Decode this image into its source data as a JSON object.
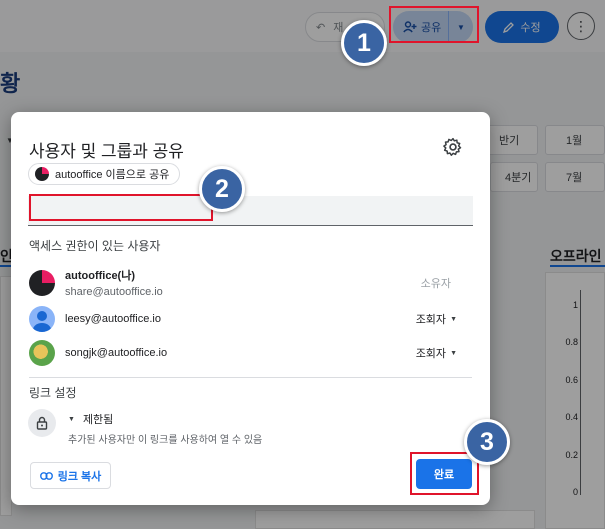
{
  "background": {
    "undo_label": "재",
    "share_label": "공유",
    "edit_label": "수정",
    "page_heading": "황",
    "filter_chips": [
      {
        "label": "반기"
      },
      {
        "label": "1월"
      },
      {
        "label": "4분기"
      },
      {
        "label": "7월"
      }
    ],
    "left_section_title": "인",
    "right_chart": {
      "title": "오프라인",
      "chart_data": {
        "type": "line",
        "title": "오프라인",
        "y_ticks": [
          "1",
          "0.8",
          "0.6",
          "0.4",
          "0.2",
          "0"
        ],
        "ylim": [
          0,
          1
        ]
      }
    }
  },
  "dialog": {
    "title": "사용자 및 그룹과 공유",
    "identity_chip": "autooffice 이름으로 공유",
    "add_input_value": "",
    "access_section_label": "액세스 권한이 있는 사용자",
    "people": [
      {
        "name": "autooffice(나)",
        "email": "share@autooffice.io",
        "role": "소유자"
      },
      {
        "name": "leesy@autooffice.io",
        "email": "",
        "role": "조회자"
      },
      {
        "name": "songjk@autooffice.io",
        "email": "",
        "role": "조회자"
      }
    ],
    "link_section_label": "링크 설정",
    "restriction_label": "제한됨",
    "restriction_desc": "추가된 사용자만 이 링크를 사용하여 열 수 있음",
    "copy_link_label": "링크 복사",
    "done_label": "완료"
  },
  "annotations": {
    "steps": [
      "1",
      "2",
      "3"
    ],
    "highlight_color": "#e0142b",
    "badge_color": "#3a64a3"
  }
}
